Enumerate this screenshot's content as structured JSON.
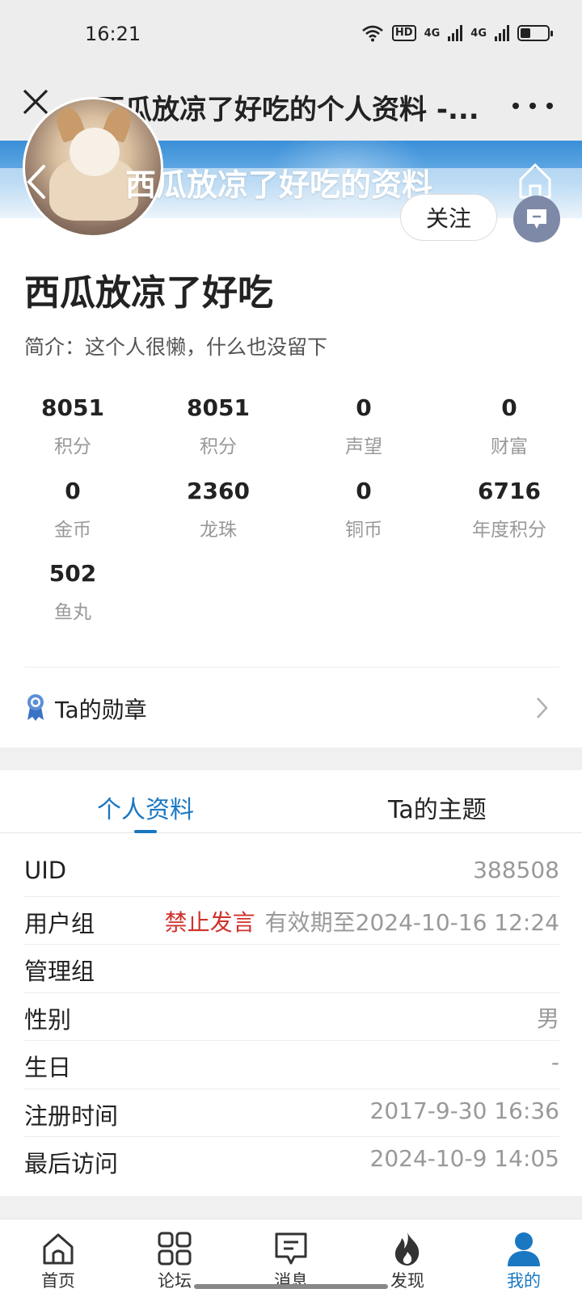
{
  "status_bar": {
    "time": "16:21",
    "hd_label": "HD",
    "signal1": "4G",
    "signal2": "4G"
  },
  "title_bar": {
    "title": "西瓜放凉了好吃的个人资料 -..."
  },
  "profile": {
    "banner_title": "西瓜放凉了好吃的资料",
    "follow_label": "关注",
    "username": "西瓜放凉了好吃",
    "bio": "简介：这个人很懒，什么也没留下"
  },
  "stats": [
    {
      "value": "8051",
      "label": "积分"
    },
    {
      "value": "8051",
      "label": "积分"
    },
    {
      "value": "0",
      "label": "声望"
    },
    {
      "value": "0",
      "label": "财富"
    },
    {
      "value": "0",
      "label": "金币"
    },
    {
      "value": "2360",
      "label": "龙珠"
    },
    {
      "value": "0",
      "label": "铜币"
    },
    {
      "value": "6716",
      "label": "年度积分"
    },
    {
      "value": "502",
      "label": "鱼丸"
    }
  ],
  "medal": {
    "label": "Ta的勋章"
  },
  "tabs": [
    {
      "label": "个人资料"
    },
    {
      "label": "Ta的主题"
    }
  ],
  "info": {
    "uid_key": "UID",
    "uid_val": "388508",
    "group_key": "用户组",
    "group_banned": "禁止发言",
    "group_val": "有效期至2024-10-16 12:24",
    "admin_key": "管理组",
    "gender_key": "性别",
    "gender_val": "男",
    "birthday_key": "生日",
    "birthday_val": "-",
    "reg_key": "注册时间",
    "reg_val": "2017-9-30 16:36",
    "last_key": "最后访问",
    "last_val": "2024-10-9 14:05"
  },
  "nav": [
    {
      "label": "首页",
      "icon": "home-icon"
    },
    {
      "label": "论坛",
      "icon": "grid-icon"
    },
    {
      "label": "消息",
      "icon": "message-icon"
    },
    {
      "label": "发现",
      "icon": "fire-icon"
    },
    {
      "label": "我的",
      "icon": "user-icon"
    }
  ],
  "colors": {
    "accent": "#1a78c2",
    "banned": "#d0302b",
    "banner": "#3a8fd8"
  }
}
